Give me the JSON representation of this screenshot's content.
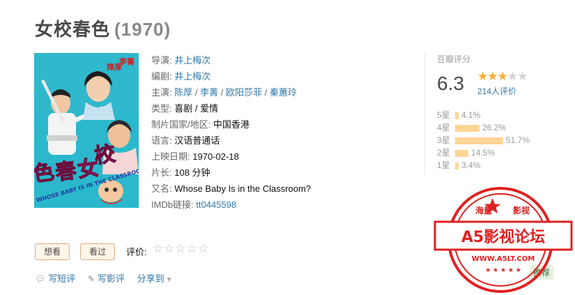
{
  "movie": {
    "title": "女校春色",
    "year": "(1970)"
  },
  "poster": {
    "cast_top_right": "李菁",
    "cast_top_left": "陳厚",
    "title_vertical": "女校春色",
    "english_caption": "WHOSE BABY IS IN THE CLASSROOM?"
  },
  "info": {
    "director_label": "导演:",
    "director": "井上梅次",
    "writer_label": "编剧:",
    "writer": "井上梅次",
    "cast_label": "主演:",
    "cast": [
      "陈厚",
      "李菁",
      "欧阳莎菲",
      "秦蕙玲"
    ],
    "cast_sep": "/",
    "genre_label": "类型:",
    "genres": "喜剧 / 爱情",
    "country_label": "制片国家/地区:",
    "country": "中国香港",
    "language_label": "语言:",
    "language": "汉语普通话",
    "release_label": "上映日期:",
    "release": "1970-02-18",
    "runtime_label": "片长:",
    "runtime": "108 分钟",
    "aka_label": "又名:",
    "aka": "Whose Baby Is in the Classroom?",
    "imdb_label": "IMDb链接:",
    "imdb": "tt0445598"
  },
  "rating": {
    "header": "豆瓣评分",
    "score": "6.3",
    "stars_filled": 3,
    "stars_total": 5,
    "star_glyph": "★",
    "votes": "214人评价",
    "distribution": [
      {
        "label": "5星",
        "percent": 4.1,
        "text": "4.1%"
      },
      {
        "label": "4星",
        "percent": 26.2,
        "text": "26.2%"
      },
      {
        "label": "3星",
        "percent": 51.7,
        "text": "51.7%"
      },
      {
        "label": "2星",
        "percent": 14.5,
        "text": "14.5%"
      },
      {
        "label": "1星",
        "percent": 3.4,
        "text": "3.4%"
      }
    ]
  },
  "interest": {
    "want_label": "想看",
    "seen_label": "看过",
    "rate_label": "评价:",
    "rate_stars": "☆☆☆☆☆"
  },
  "actions": {
    "short_review": "写短评",
    "review": "写影评",
    "share": "分享到",
    "short_review_icon": "comment-icon",
    "review_icon": "pencil-icon"
  },
  "recommend": "推荐",
  "watermark": {
    "top_text": "海量",
    "top_text_right": "影视",
    "main": "A5影视论坛",
    "url": "WWW.A5LT.COM"
  },
  "colors": {
    "link": "#3377aa",
    "star": "#ffac2d",
    "bar": "#ffd596",
    "stamp_red": "#e02020",
    "poster_bg": "#1fb2c9"
  }
}
